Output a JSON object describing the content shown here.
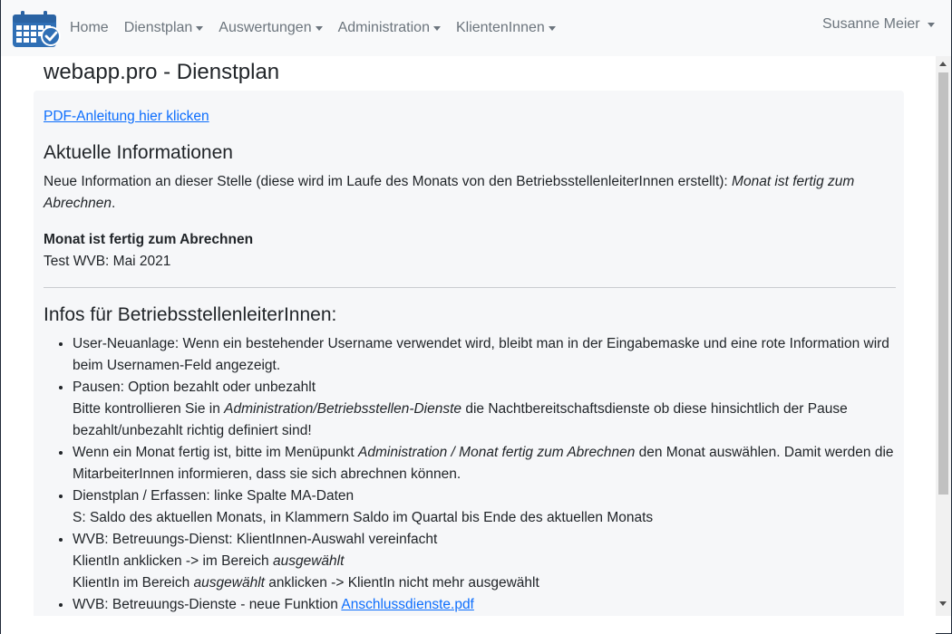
{
  "nav": {
    "brand_icon": "calendar-check-icon",
    "items": [
      {
        "label": "Home",
        "dropdown": false
      },
      {
        "label": "Dienstplan",
        "dropdown": true
      },
      {
        "label": "Auswertungen",
        "dropdown": true
      },
      {
        "label": "Administration",
        "dropdown": true
      },
      {
        "label": "KlientenInnen",
        "dropdown": true
      }
    ],
    "user": "Susanne Meier"
  },
  "page": {
    "title": "webapp.pro - Dienstplan",
    "pdf_link": "PDF-Anleitung hier klicken",
    "news": {
      "heading": "Aktuelle Informationen",
      "intro_text": "Neue Information an dieser Stelle (diese wird im Laufe des Monats von den BetriebsstellenleiterInnen erstellt): ",
      "intro_em": "Monat ist fertig zum Abrechnen",
      "intro_end": ".",
      "item_title": "Monat ist fertig zum Abrechnen",
      "item_text": "Test WVB: Mai 2021"
    },
    "infos": {
      "heading": "Infos für BetriebsstellenleiterInnen:",
      "items": [
        {
          "line1": "User-Neuanlage: Wenn ein bestehender Username verwendet wird, bleibt man in der Eingabemaske und eine rote Information wird beim Usernamen-Feld angezeigt."
        },
        {
          "line1": "Pausen: Option bezahlt oder unbezahlt",
          "line2_a": "Bitte kontrollieren Sie in ",
          "line2_em": "Administration/Betriebsstellen-Dienste",
          "line2_b": " die Nachtbereitschaftsdienste ob diese hinsichtlich der Pause bezahlt/unbezahlt richtig definiert sind!"
        },
        {
          "line1_a": "Wenn ein Monat fertig ist, bitte im Menüpunkt ",
          "line1_em": "Administration / Monat fertig zum Abrechnen",
          "line1_b": " den Monat auswählen. Damit werden die MitarbeiterInnen informieren, dass sie sich abrechnen können."
        },
        {
          "line1": "Dienstplan / Erfassen: linke Spalte MA-Daten",
          "line2": "S: Saldo des aktuellen Monats, in Klammern Saldo im Quartal bis Ende des aktuellen Monats"
        },
        {
          "line1": "WVB: Betreuungs-Dienst: KlientInnen-Auswahl vereinfacht",
          "line2_a": "KlientIn anklicken -> im Bereich ",
          "line2_em": "ausgewählt",
          "line3_a": "KlientIn im Bereich ",
          "line3_em": "ausgewählt",
          "line3_b": " anklicken -> KlientIn nicht mehr ausgewählt"
        },
        {
          "line1": "WVB: Betreuungs-Dienste - neue Funktion ",
          "link": "Anschlussdienste.pdf"
        }
      ]
    }
  },
  "colors": {
    "link": "#0d6efd",
    "brand_blue": "#2f6fb5",
    "navbar_bg": "#f8f9fa"
  }
}
